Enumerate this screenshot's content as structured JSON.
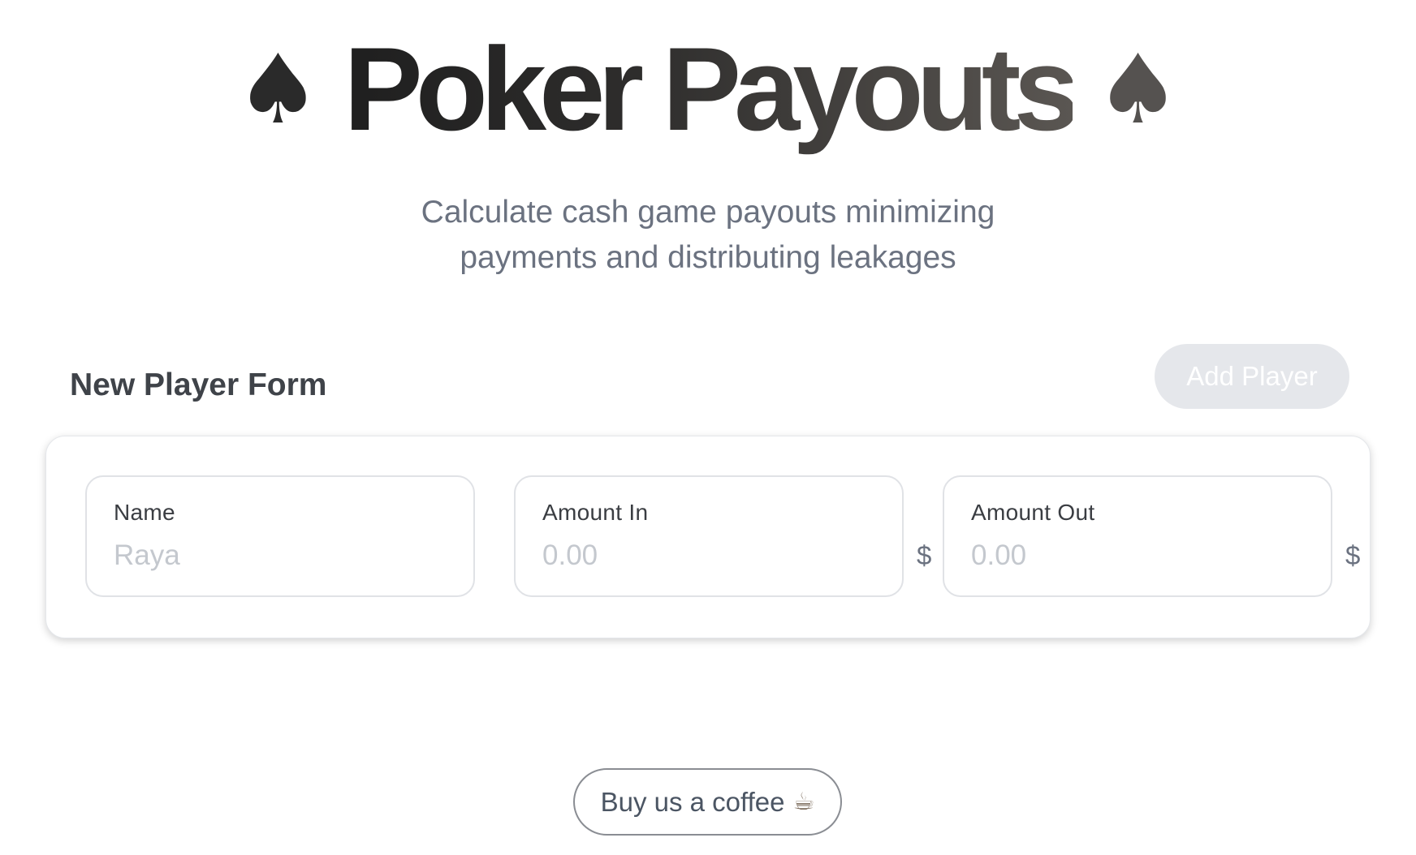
{
  "header": {
    "title": "Poker Payouts",
    "left_icon": "spade-icon",
    "right_icon": "spade-icon",
    "subtitle_line1": "Calculate cash game payouts minimizing",
    "subtitle_line2": "payments and distributing leakages"
  },
  "form": {
    "heading": "New Player Form",
    "add_player_label": "Add Player",
    "fields": [
      {
        "label": "Name",
        "value": "",
        "placeholder": "Raya",
        "suffix": ""
      },
      {
        "label": "Amount In",
        "value": "",
        "placeholder": "0.00",
        "suffix": "$"
      },
      {
        "label": "Amount Out",
        "value": "",
        "placeholder": "0.00",
        "suffix": "$"
      }
    ]
  },
  "footer": {
    "coffee_label": "Buy us a coffee",
    "coffee_icon": "coffee-cup-icon"
  },
  "colors": {
    "subtitle": "#6b7280",
    "disabled_button_bg": "#e5e7eb",
    "placeholder": "#c4c8ce"
  }
}
